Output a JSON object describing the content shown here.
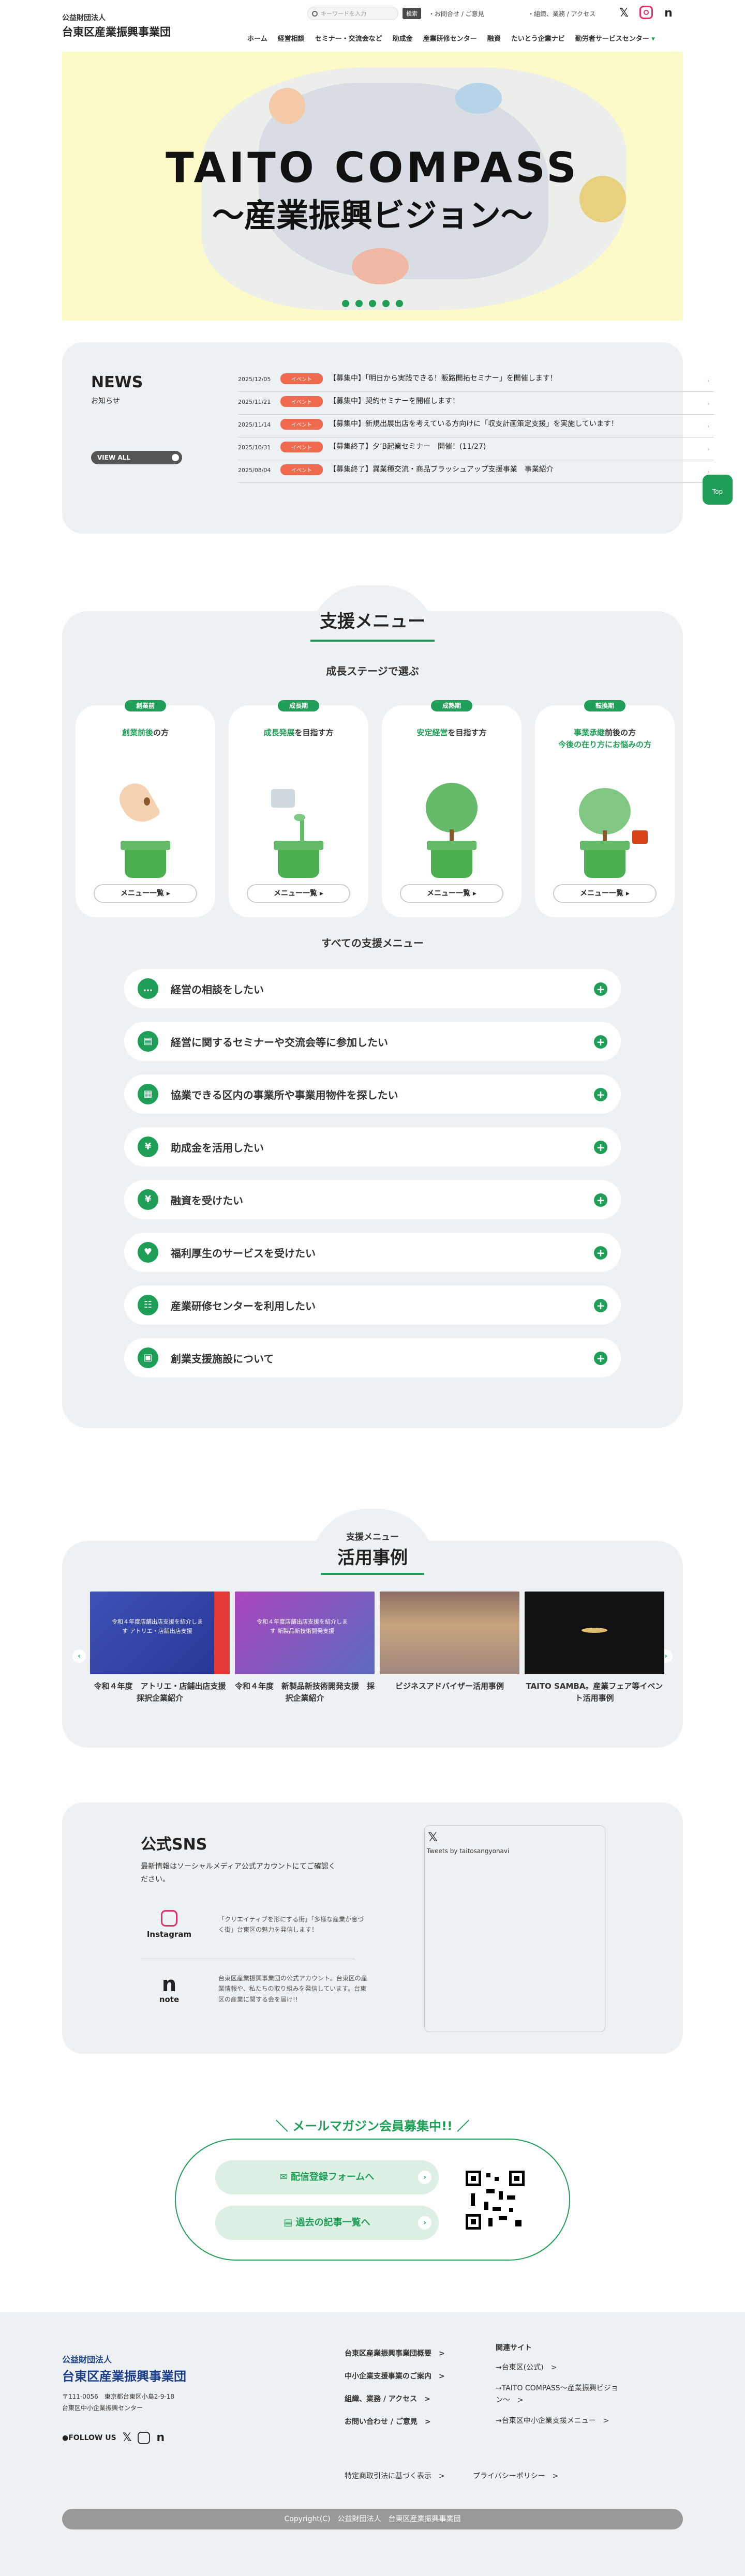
{
  "header": {
    "org_type": "公益財団法人",
    "org_name": "台東区産業振興事業団",
    "search_placeholder": "キーワードを入力",
    "search_button": "検索",
    "util_links": [
      "・お問合せ / ご意見",
      "・組織、業務 / アクセス"
    ],
    "sns_icons": [
      "x-icon",
      "instagram-icon",
      "note-icon"
    ],
    "nav": [
      "ホーム",
      "経営相談",
      "セミナー・交流会など",
      "助成金",
      "産業研修センター",
      "融資",
      "たいとう企業ナビ",
      "勤労者サービスセンター"
    ],
    "nav_caret": "▾"
  },
  "hero": {
    "title": "TAITO COMPASS",
    "subtitle": "〜産業振興ビジョン〜",
    "slides": 5
  },
  "news": {
    "title": "NEWS",
    "subtitle": "お知らせ",
    "view_all": "VIEW ALL",
    "items": [
      {
        "date": "2025/12/05",
        "tag": "イベント",
        "text": "【募集中】「明日から実践できる！販路開拓セミナー」を開催します！"
      },
      {
        "date": "2025/11/21",
        "tag": "イベント",
        "text": "【募集中】契約セミナーを開催します！"
      },
      {
        "date": "2025/11/14",
        "tag": "イベント",
        "text": "【募集中】新規出展出店を考えている方向けに「収支計画策定支援」を実施しています！"
      },
      {
        "date": "2025/10/31",
        "tag": "イベント",
        "text": "【募集終了】夕’B起業セミナー　開催！(11/27)"
      },
      {
        "date": "2025/08/04",
        "tag": "イベント",
        "text": "【募集終了】異業種交流・商品ブラッシュアップ支援事業　事業紹介"
      }
    ]
  },
  "to_top": "Top",
  "support": {
    "title": "支援メニュー",
    "stage_title": "成長ステージで選ぶ",
    "cards": [
      {
        "badge": "創業前",
        "hl": "創業前後",
        "rest": "の方",
        "line2": "",
        "button": "メニュー一覧 ▸"
      },
      {
        "badge": "成長期",
        "hl": "成長発展",
        "rest": "を目指す方",
        "line2": "",
        "button": "メニュー一覧 ▸"
      },
      {
        "badge": "成熟期",
        "hl": "安定経営",
        "rest": "を目指す方",
        "line2": "",
        "button": "メニュー一覧 ▸"
      },
      {
        "badge": "転換期",
        "hl": "事業承継",
        "rest": "前後の方",
        "line2": "今後の在り方にお悩みの方",
        "button": "メニュー一覧 ▸"
      }
    ],
    "all_title": "すべての支援メニュー",
    "items": [
      {
        "icon": "chat-icon",
        "glyph": "…",
        "label": "経営の相談をしたい"
      },
      {
        "icon": "seminar-icon",
        "glyph": "▤",
        "label": "経営に関するセミナーや交流会等に参加したい"
      },
      {
        "icon": "building-icon",
        "glyph": "▦",
        "label": "協業できる区内の事業所や事業用物件を探したい"
      },
      {
        "icon": "money-bag-icon",
        "glyph": "¥",
        "label": "助成金を活用したい"
      },
      {
        "icon": "loan-icon",
        "glyph": "¥",
        "label": "融資を受けたい"
      },
      {
        "icon": "heart-icon",
        "glyph": "♥",
        "label": "福利厚生のサービスを受けたい"
      },
      {
        "icon": "people-icon",
        "glyph": "☷",
        "label": "産業研修センターを利用したい"
      },
      {
        "icon": "facility-icon",
        "glyph": "▣",
        "label": "創業支援施設について"
      }
    ],
    "plus": "+"
  },
  "examples": {
    "sub": "支援メニュー",
    "title": "活用事例",
    "items": [
      {
        "caption": "令和４年度　アトリエ・店舗出店支援　採択企業紹介",
        "img_text": "令和４年度店舗出店支援を紹介します アトリエ・店舗出店支援"
      },
      {
        "caption": "令和４年度　新製品新技術開発支援　採択企業紹介",
        "img_text": "令和４年度店舗出店支援を紹介します 新製品新技術開発支援"
      },
      {
        "caption": "ビジネスアドバイザー活用事例",
        "img_text": ""
      },
      {
        "caption": "TAITO SAMBA。産業フェア等イベント活用事例",
        "img_text": ""
      }
    ],
    "prev": "‹",
    "next": "›"
  },
  "sns": {
    "title": "公式SNS",
    "desc": "最新情報はソーシャルメディア公式アカウントにてご確認ください。",
    "instagram_label": "Instagram",
    "instagram_text": "「クリエイティブを形にする街」「多様な産業が息づく街」台東区の魅力を発信します！",
    "note_label": "note",
    "note_text": "台東区産業振興事業団の公式アカウント。台東区の産業情報や、私たちの取り組みを発信しています。台東区の産業に関する会を届け!!",
    "twitter_label": "Tweets by taitosangyonavi"
  },
  "mailmag": {
    "title": "＼ メールマガジン会員募集中!! ／",
    "btn1": "配信登録フォームへ",
    "btn2": "過去の記事一覧へ"
  },
  "footer": {
    "org_type": "公益財団法人",
    "org_name": "台東区産業振興事業団",
    "address": "〒111-0056　東京都台東区小島2-9-18",
    "address2": "台東区中小企業振興センター",
    "follow": "●FOLLOW US",
    "col1": [
      "台東区産業振興事業団概要　>",
      "中小企業支援事業のご案内　>",
      "組織、業務 / アクセス　>",
      "お問い合わせ / ご意見　>"
    ],
    "col2_title": "関連サイト",
    "col2": [
      "→台東区(公式)　>",
      "→TAITO COMPASS〜産業振興ビジョン〜　>",
      "→台東区中小企業支援メニュー　>"
    ],
    "sub_links": [
      "特定商取引法に基づく表示　>",
      "プライバシーポリシー　>"
    ],
    "copyright": "Copyright(C)　公益財団法人　台東区産業振興事業団"
  },
  "colors": {
    "accent": "#1e9e56",
    "tag": "#f06a4f",
    "panel": "#eef1f3",
    "hero_bg": "#fdfac9"
  }
}
